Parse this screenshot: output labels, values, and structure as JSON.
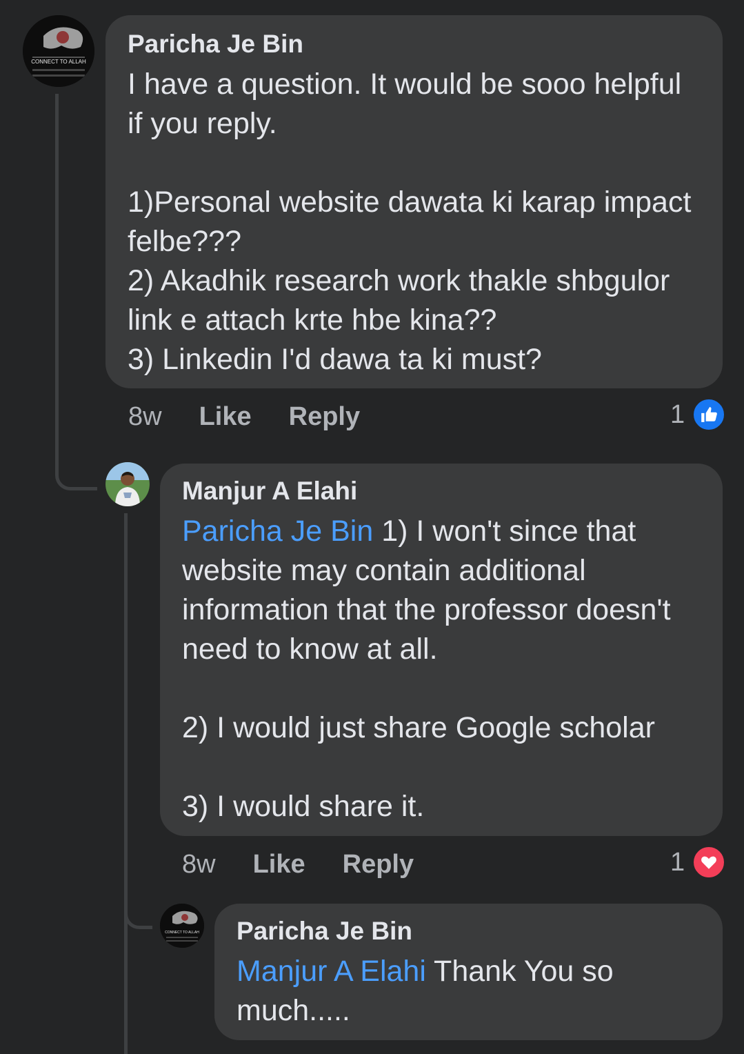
{
  "comments": [
    {
      "author": "Paricha Je Bin",
      "avatar_text": "CONNECT TO ALLAH",
      "mention": "",
      "text": "I have a question. It would be sooo helpful if you reply.\n\n1)Personal website dawata ki karap impact felbe???\n2) Akadhik research work thakle shbgulor link e attach krte hbe kina??\n3) Linkedin I'd dawa ta ki must?",
      "time": "8w",
      "like_label": "Like",
      "reply_label": "Reply",
      "reaction_count": "1",
      "reaction_icon": "like-icon",
      "reaction_color": "#1877f2"
    },
    {
      "author": "Manjur A Elahi",
      "mention": "Paricha Je Bin",
      "text": " 1) I won't since that website may contain additional information that the professor doesn't need to know at all.\n\n2) I would just share Google scholar\n\n3) I would share it.",
      "time": "8w",
      "like_label": "Like",
      "reply_label": "Reply",
      "reaction_count": "1",
      "reaction_icon": "love-icon",
      "reaction_color": "#f33e58"
    },
    {
      "author": "Paricha Je Bin",
      "avatar_text": "CONNECT TO ALLAH",
      "mention": "Manjur A Elahi",
      "text": " Thank You so much....."
    }
  ]
}
